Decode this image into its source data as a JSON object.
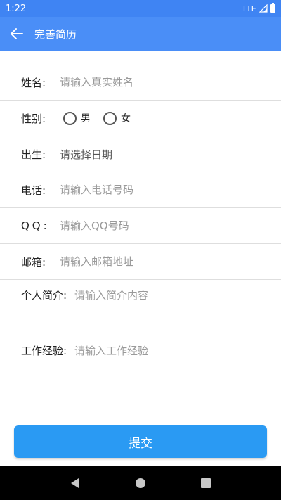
{
  "status_bar": {
    "time": "1:22",
    "network": "LTE"
  },
  "app_bar": {
    "title": "完善简历"
  },
  "form": {
    "name": {
      "label": "姓名:",
      "placeholder": "请输入真实姓名"
    },
    "gender": {
      "label": "性别:",
      "options": [
        "男",
        "女"
      ]
    },
    "birth": {
      "label": "出生:",
      "value": "请选择日期"
    },
    "phone": {
      "label": "电话:",
      "placeholder": "请输入电话号码"
    },
    "qq": {
      "label": "QQ:",
      "placeholder": "请输入QQ号码"
    },
    "email": {
      "label": "邮箱:",
      "placeholder": "请输入邮箱地址"
    },
    "intro": {
      "label": "个人简介:",
      "placeholder": "请输入简介内容"
    },
    "experience": {
      "label": "工作经验:",
      "placeholder": "请输入工作经验"
    }
  },
  "submit": {
    "label": "提交"
  },
  "colors": {
    "primary": "#4a8ef7",
    "button": "#2a9af3",
    "divider": "#dedede",
    "placeholder": "#9a9a9a"
  }
}
